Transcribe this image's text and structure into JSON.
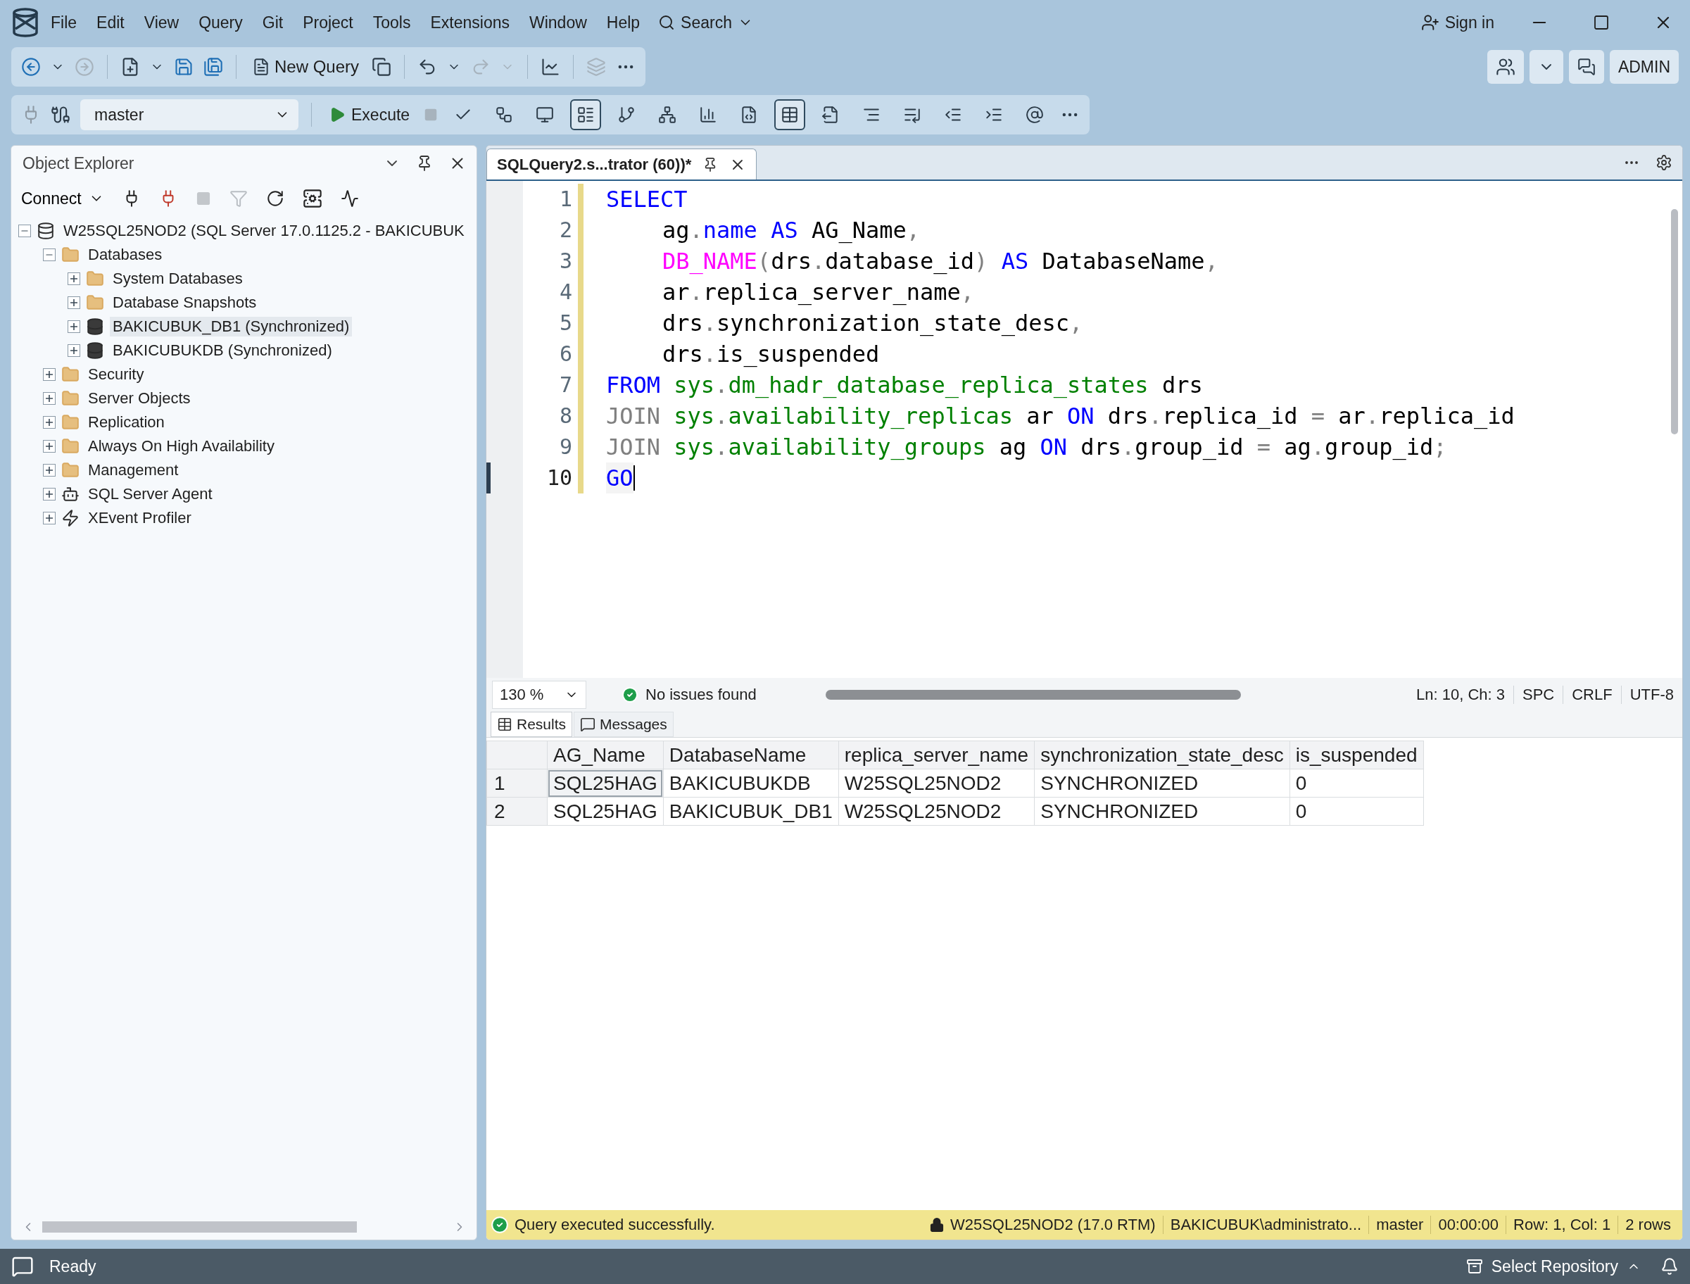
{
  "menu_bar": {
    "items": [
      "File",
      "Edit",
      "View",
      "Query",
      "Git",
      "Project",
      "Tools",
      "Extensions",
      "Window",
      "Help"
    ],
    "search": "Search",
    "sign_in": "Sign in"
  },
  "standard_toolbar": {
    "new_query": "New Query"
  },
  "account": {
    "label": "ADMIN"
  },
  "query_toolbar": {
    "database": "master",
    "execute": "Execute",
    "toggles": [
      {
        "pressed": false
      },
      {
        "pressed": false
      },
      {
        "pressed": false
      },
      {
        "pressed": true
      },
      {
        "pressed": false
      },
      {
        "pressed": false
      },
      {
        "pressed": false
      },
      {
        "pressed": false
      },
      {
        "pressed": true
      },
      {
        "pressed": false
      },
      {
        "pressed": false
      },
      {
        "pressed": false
      },
      {
        "pressed": false
      },
      {
        "pressed": false
      },
      {
        "pressed": false
      }
    ]
  },
  "object_explorer": {
    "title": "Object Explorer",
    "connect": "Connect",
    "tree": [
      {
        "label": "W25SQL25NOD2 (SQL Server 17.0.1125.2 - BAKICUBUK",
        "kind": "server",
        "expanded": true,
        "selected": false,
        "children": [
          {
            "label": "Databases",
            "kind": "folder",
            "expanded": true,
            "selected": false,
            "children": [
              {
                "label": "System Databases",
                "kind": "folder",
                "expanded": false,
                "selected": false
              },
              {
                "label": "Database Snapshots",
                "kind": "folder",
                "expanded": false,
                "selected": false
              },
              {
                "label": "BAKICUBUK_DB1 (Synchronized)",
                "kind": "database",
                "expanded": false,
                "selected": true
              },
              {
                "label": "BAKICUBUKDB (Synchronized)",
                "kind": "database",
                "expanded": false,
                "selected": false
              }
            ]
          },
          {
            "label": "Security",
            "kind": "folder",
            "expanded": false,
            "selected": false
          },
          {
            "label": "Server Objects",
            "kind": "folder",
            "expanded": false,
            "selected": false
          },
          {
            "label": "Replication",
            "kind": "folder",
            "expanded": false,
            "selected": false
          },
          {
            "label": "Always On High Availability",
            "kind": "folder",
            "expanded": false,
            "selected": false
          },
          {
            "label": "Management",
            "kind": "folder",
            "expanded": false,
            "selected": false
          },
          {
            "label": "SQL Server Agent",
            "kind": "agent",
            "expanded": false,
            "selected": false
          },
          {
            "label": "XEvent Profiler",
            "kind": "profiler",
            "expanded": false,
            "selected": false
          }
        ]
      }
    ]
  },
  "editor": {
    "tab": {
      "title": "SQLQuery2.s...trator (60))*",
      "selected": true
    },
    "lines": [
      {
        "number": "1",
        "indented": false,
        "current": false,
        "tokens": [
          {
            "text": "SELECT",
            "kind": "keyword"
          }
        ]
      },
      {
        "number": "2",
        "indented": true,
        "current": false,
        "tokens": [
          {
            "text": "ag",
            "kind": "plain"
          },
          {
            "text": ".",
            "kind": "operator"
          },
          {
            "text": "name ",
            "kind": "keyword"
          },
          {
            "text": "AS ",
            "kind": "keyword"
          },
          {
            "text": "AG_Name",
            "kind": "plain"
          },
          {
            "text": ",",
            "kind": "operator"
          }
        ]
      },
      {
        "number": "3",
        "indented": true,
        "current": false,
        "tokens": [
          {
            "text": "DB_NAME",
            "kind": "function"
          },
          {
            "text": "(",
            "kind": "operator"
          },
          {
            "text": "drs",
            "kind": "plain"
          },
          {
            "text": ".",
            "kind": "operator"
          },
          {
            "text": "database_id",
            "kind": "plain"
          },
          {
            "text": ") ",
            "kind": "operator"
          },
          {
            "text": "AS ",
            "kind": "keyword"
          },
          {
            "text": "DatabaseName",
            "kind": "plain"
          },
          {
            "text": ",",
            "kind": "operator"
          }
        ]
      },
      {
        "number": "4",
        "indented": true,
        "current": false,
        "tokens": [
          {
            "text": "ar",
            "kind": "plain"
          },
          {
            "text": ".",
            "kind": "operator"
          },
          {
            "text": "replica_server_name",
            "kind": "plain"
          },
          {
            "text": ",",
            "kind": "operator"
          }
        ]
      },
      {
        "number": "5",
        "indented": true,
        "current": false,
        "tokens": [
          {
            "text": "drs",
            "kind": "plain"
          },
          {
            "text": ".",
            "kind": "operator"
          },
          {
            "text": "synchronization_state_desc",
            "kind": "plain"
          },
          {
            "text": ",",
            "kind": "operator"
          }
        ]
      },
      {
        "number": "6",
        "indented": true,
        "current": false,
        "tokens": [
          {
            "text": "drs",
            "kind": "plain"
          },
          {
            "text": ".",
            "kind": "operator"
          },
          {
            "text": "is_suspended",
            "kind": "plain"
          }
        ]
      },
      {
        "number": "7",
        "indented": false,
        "current": false,
        "tokens": [
          {
            "text": "FROM ",
            "kind": "keyword"
          },
          {
            "text": "sys",
            "kind": "system"
          },
          {
            "text": ".",
            "kind": "operator"
          },
          {
            "text": "dm_hadr_database_replica_states ",
            "kind": "system"
          },
          {
            "text": "drs",
            "kind": "plain"
          }
        ]
      },
      {
        "number": "8",
        "indented": false,
        "current": false,
        "tokens": [
          {
            "text": "JOIN ",
            "kind": "operator"
          },
          {
            "text": "sys",
            "kind": "system"
          },
          {
            "text": ".",
            "kind": "operator"
          },
          {
            "text": "availability_replicas ",
            "kind": "system"
          },
          {
            "text": "ar ",
            "kind": "plain"
          },
          {
            "text": "ON ",
            "kind": "keyword"
          },
          {
            "text": "drs",
            "kind": "plain"
          },
          {
            "text": ".",
            "kind": "operator"
          },
          {
            "text": "replica_id ",
            "kind": "plain"
          },
          {
            "text": "= ",
            "kind": "operator"
          },
          {
            "text": "ar",
            "kind": "plain"
          },
          {
            "text": ".",
            "kind": "operator"
          },
          {
            "text": "replica_id",
            "kind": "plain"
          }
        ]
      },
      {
        "number": "9",
        "indented": false,
        "current": false,
        "tokens": [
          {
            "text": "JOIN ",
            "kind": "operator"
          },
          {
            "text": "sys",
            "kind": "system"
          },
          {
            "text": ".",
            "kind": "operator"
          },
          {
            "text": "availability_groups ",
            "kind": "system"
          },
          {
            "text": "ag ",
            "kind": "plain"
          },
          {
            "text": "ON ",
            "kind": "keyword"
          },
          {
            "text": "drs",
            "kind": "plain"
          },
          {
            "text": ".",
            "kind": "operator"
          },
          {
            "text": "group_id ",
            "kind": "plain"
          },
          {
            "text": "= ",
            "kind": "operator"
          },
          {
            "text": "ag",
            "kind": "plain"
          },
          {
            "text": ".",
            "kind": "operator"
          },
          {
            "text": "group_id",
            "kind": "plain"
          },
          {
            "text": ";",
            "kind": "operator"
          }
        ]
      },
      {
        "number": "10",
        "indented": false,
        "current": true,
        "tokens": [
          {
            "text": "GO",
            "kind": "keyword"
          }
        ]
      }
    ],
    "zoom": "130 %",
    "issues": "No issues found",
    "position": "Ln: 10, Ch: 3",
    "indent_mode": "SPC",
    "line_endings": "CRLF",
    "encoding": "UTF-8"
  },
  "results": {
    "tabs": [
      {
        "label": "Results",
        "selected": true
      },
      {
        "label": "Messages",
        "selected": false
      }
    ],
    "columns": [
      "AG_Name",
      "DatabaseName",
      "replica_server_name",
      "synchronization_state_desc",
      "is_suspended"
    ],
    "rows": [
      {
        "number": "1",
        "cells": [
          {
            "text": "SQL25HAG",
            "selected": true
          },
          {
            "text": "BAKICUBUKDB",
            "selected": false
          },
          {
            "text": "W25SQL25NOD2",
            "selected": false
          },
          {
            "text": "SYNCHRONIZED",
            "selected": false
          },
          {
            "text": "0",
            "selected": false
          }
        ]
      },
      {
        "number": "2",
        "cells": [
          {
            "text": "SQL25HAG",
            "selected": false
          },
          {
            "text": "BAKICUBUK_DB1",
            "selected": false
          },
          {
            "text": "W25SQL25NOD2",
            "selected": false
          },
          {
            "text": "SYNCHRONIZED",
            "selected": false
          },
          {
            "text": "0",
            "selected": false
          }
        ]
      }
    ]
  },
  "query_status": {
    "message": "Query executed successfully.",
    "server": "W25SQL25NOD2 (17.0 RTM)",
    "user": "BAKICUBUK\\administrato...",
    "database": "master",
    "elapsed": "00:00:00",
    "cursor": "Row: 1, Col: 1",
    "row_count": "2 rows"
  },
  "status_bar": {
    "text": "Ready",
    "repository": "Select Repository"
  }
}
